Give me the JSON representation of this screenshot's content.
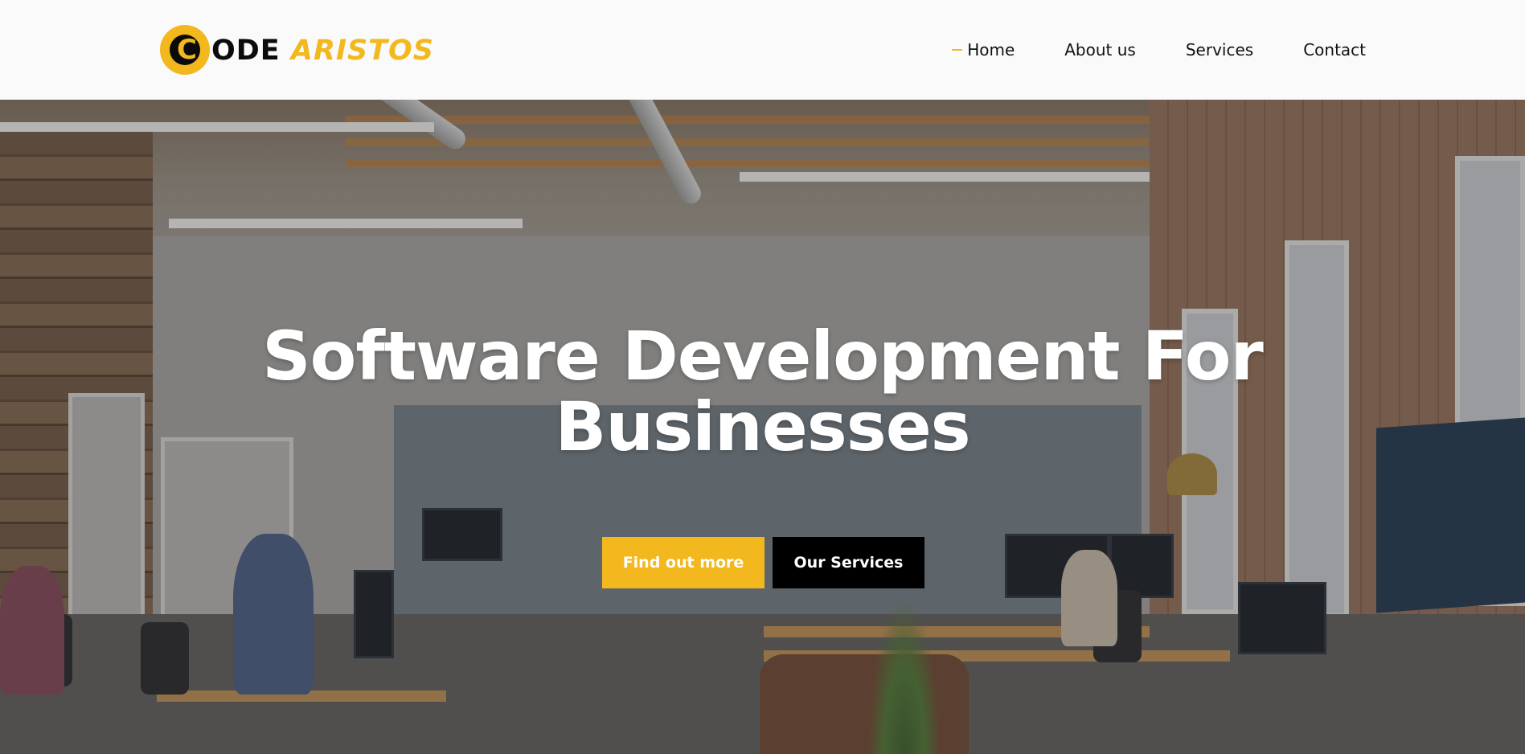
{
  "header": {
    "logo": {
      "text_dark": "ODE",
      "text_gold": "ARISTOS",
      "mark": "C"
    },
    "nav": [
      {
        "label": "Home",
        "active": true
      },
      {
        "label": "About us",
        "active": false
      },
      {
        "label": "Services",
        "active": false
      },
      {
        "label": "Contact",
        "active": false
      }
    ]
  },
  "hero": {
    "title_line1": "Software Development For",
    "title_line2": "Businesses",
    "primary_button": "Find out more",
    "secondary_button": "Our Services"
  },
  "colors": {
    "accent": "#f2b81d",
    "header_bg": "#fafafa",
    "secondary_button_bg": "#000000"
  }
}
